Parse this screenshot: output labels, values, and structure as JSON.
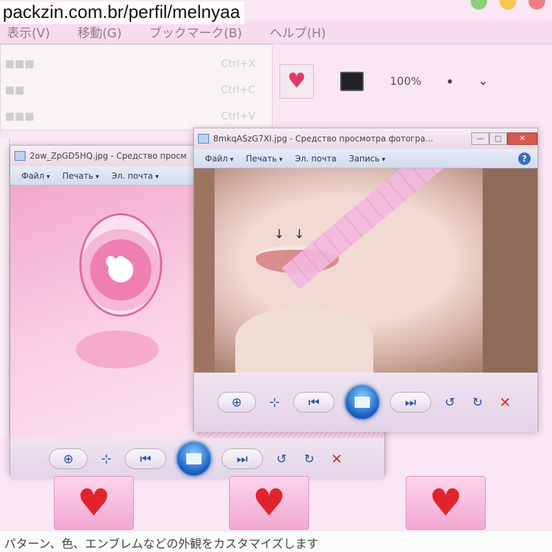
{
  "watermark": "packzin.com.br/perfil/melnyaa",
  "background_app": {
    "menu": [
      "表示(V)",
      "移動(G)",
      "ブックマーク(B)",
      "ヘルプ(H)"
    ],
    "edit_menu_shortcuts": [
      "Ctrl+X",
      "Ctrl+C",
      "Ctrl+V"
    ],
    "zoom_label": "100%"
  },
  "window_left": {
    "title": "2ow_ZpGD5HQ.jpg - Средство просм",
    "menu": [
      "Файл",
      "Печать",
      "Эл. почта"
    ]
  },
  "window_right": {
    "title": "8mkqASzG7XI.jpg - Средство просмотра фотогра...",
    "menu": [
      "Файл",
      "Печать",
      "Эл. почта",
      "Запись"
    ],
    "help": "?"
  },
  "status_text": "パターン、色、エンブレムなどの外観をカスタマイズします",
  "icons": {
    "zoom": "⊕",
    "fit": "⊹",
    "prev": "⏮",
    "next": "⏭",
    "rotate_ccw": "↺",
    "rotate_cw": "↻",
    "delete": "✕"
  },
  "colors": {
    "background": "#fbe6f3",
    "accent_blue": "#1d64c6",
    "heart_red": "#e1242c"
  }
}
